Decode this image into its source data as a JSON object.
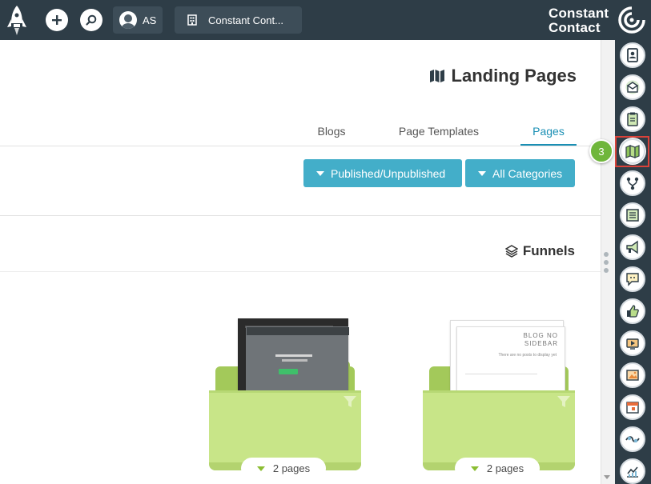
{
  "header": {
    "account_label": "Constant Cont...",
    "user_initials": "AS",
    "brand_line_1": "Constant",
    "brand_line_2": "Contact",
    "icons": [
      "rocket-icon",
      "plus-icon",
      "search-icon",
      "avatar",
      "building-icon",
      "constant-contact-logo"
    ]
  },
  "page": {
    "title": "Landing Pages",
    "tabs": [
      {
        "label": "Pages",
        "active": true
      },
      {
        "label": "Page Templates",
        "active": false
      },
      {
        "label": "Blogs",
        "active": false
      }
    ],
    "filters": {
      "category": "All Categories",
      "status": "Published/Unpublished"
    },
    "funnels_heading": "Funnels",
    "funnels": [
      {
        "pages_label": "2 pages",
        "paper_text_1": "BLOG NO",
        "paper_text_2": "SIDEBAR",
        "paper_text_3": "There are no posts to display yet"
      },
      {
        "pages_label": "2 pages",
        "paper_text_1": "",
        "paper_text_2": "",
        "paper_text_3": ""
      }
    ]
  },
  "rail": {
    "items": [
      "contacts-icon",
      "email-icon",
      "clipboard-icon",
      "landing-pages-icon",
      "automation-icon",
      "forms-icon",
      "megaphone-icon",
      "sms-icon",
      "social-like-icon",
      "video-icon",
      "images-icon",
      "calendar-icon",
      "integrations-icon",
      "reports-icon"
    ],
    "selected_index": 3,
    "step_badge": "3"
  },
  "colors": {
    "topbar": "#2e3d47",
    "accent": "#43aec9",
    "tab_active": "#1a8fb4",
    "folder_green": "#c8e588",
    "highlight_red": "#d9423a",
    "badge_green": "#6fb63b"
  }
}
